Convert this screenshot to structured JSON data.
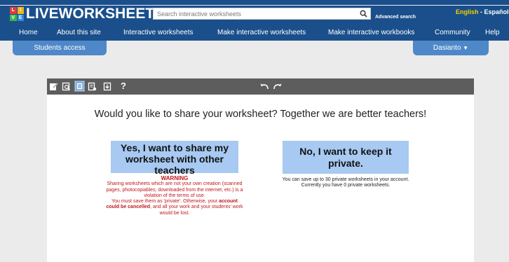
{
  "header": {
    "logo_text": "LIVEWORKSHEETS",
    "logo_letters": [
      "L",
      "I",
      "V",
      "E"
    ],
    "search_placeholder": "Search interactive worksheets",
    "advanced_search": "Advanced search",
    "lang_english": "English",
    "lang_separator": "-",
    "lang_spanish": "Español"
  },
  "nav": {
    "items": [
      "Home",
      "About this site",
      "Interactive worksheets",
      "Make interactive worksheets",
      "Make interactive workbooks",
      "Community",
      "Help"
    ]
  },
  "subnav": {
    "students_access": "Students access",
    "user_menu": "Dasianto"
  },
  "toolbar": {
    "help_label": "?"
  },
  "main": {
    "question": "Would you like to share your worksheet? Together we are better teachers!",
    "share_button": "Yes, I want to share my worksheet with other teachers",
    "keep_button": "No, I want to keep it private.",
    "warning_title": "WARNING",
    "warning_text_1": "Sharing worksheets which are not your own creation (scanned pages, photocopiables, downloaded from the internet, etc.) is a violation of the terms of use.",
    "warning_text_2a": "You must save them as 'private'. Otherwise, your",
    "warning_text_2b": "account could be cancelled",
    "warning_text_2c": ", and all your work and your students' work would be lost.",
    "private_line_1": "You can save up to 30 private worksheets in your account.",
    "private_line_2": "Currently you have 0 private worksheets."
  },
  "colors": {
    "header_bg": "#1a4f8b",
    "subnav_bg": "#4e88c8",
    "button_bg": "#a7c9f2",
    "warning_red": "#c0161b",
    "lang_active": "#f5d000"
  }
}
